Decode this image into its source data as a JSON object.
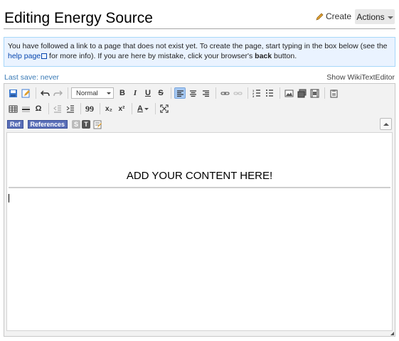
{
  "header": {
    "title": "Editing Energy Source",
    "create_label": "Create",
    "actions_label": "Actions"
  },
  "notice": {
    "part1": "You have followed a link to a page that does not exist yet. To create the page, start typing in the box below (see the ",
    "link": "help page",
    "part2": " for more info). If you are here by mistake, click your browser's ",
    "bold": "back",
    "part3": " button."
  },
  "status": {
    "last_save": "Last save: never",
    "show_wte": "Show WikiTextEditor"
  },
  "toolbar": {
    "format_select": "Normal",
    "bold": "B",
    "italic": "I",
    "underline": "U",
    "strike": "S",
    "omega": "Ω",
    "quote": "99",
    "subscript": "x₂",
    "superscript": "x²",
    "font_color": "A",
    "ref_label": "Ref",
    "references_label": "References",
    "s_label": "S",
    "t_label": "T"
  },
  "editor": {
    "content_heading": "ADD YOUR CONTENT HERE!"
  },
  "colors": {
    "link": "#0645ad",
    "notice_bg": "#eaf3ff",
    "notice_border": "#a7d7f9",
    "active_button": "#a6c8f2",
    "ref_pill": "#5a6fb8"
  }
}
